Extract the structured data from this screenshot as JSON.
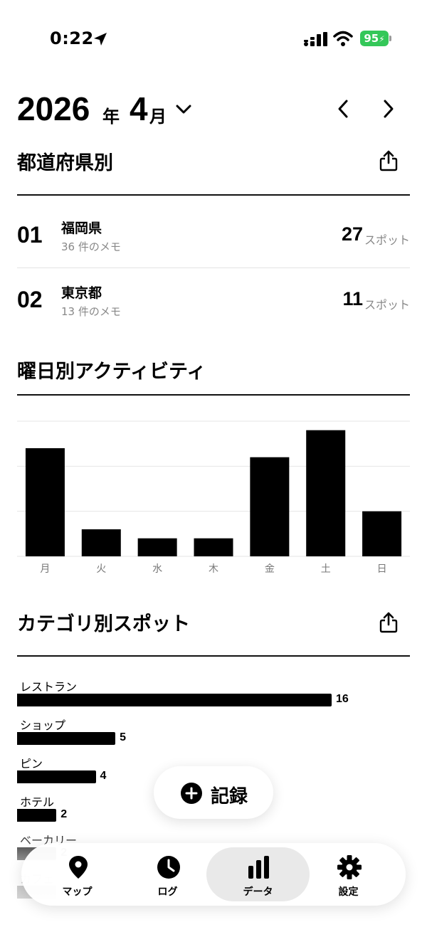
{
  "status_bar": {
    "time": "0:22",
    "battery": "95"
  },
  "header": {
    "year": "2026",
    "year_unit": "年",
    "month": "4",
    "month_unit": "月"
  },
  "prefectures": {
    "title": "都道府県別",
    "rows": [
      {
        "rank": "01",
        "name": "福岡県",
        "memo": "36 件のメモ",
        "count": "27",
        "unit": "スポット"
      },
      {
        "rank": "02",
        "name": "東京都",
        "memo": "13 件のメモ",
        "count": "11",
        "unit": "スポット"
      }
    ]
  },
  "weekday": {
    "title": "曜日別アクティビティ",
    "chart_data": {
      "type": "bar",
      "categories": [
        "月",
        "火",
        "水",
        "木",
        "金",
        "土",
        "日"
      ],
      "values": [
        12,
        3,
        2,
        2,
        11,
        14,
        5
      ],
      "ylim": [
        0,
        15
      ],
      "grid": true,
      "color": "#000000"
    }
  },
  "categories": {
    "title": "カテゴリ別スポット",
    "chart_data": {
      "type": "bar",
      "orientation": "horizontal",
      "categories": [
        "レストラン",
        "ショップ",
        "ピン",
        "ホテル",
        "ベーカリー",
        "カフェ"
      ],
      "values": [
        16,
        5,
        4,
        2,
        2,
        2
      ],
      "xlim": [
        0,
        16
      ]
    }
  },
  "record_button": {
    "label": "記録"
  },
  "tabs": [
    {
      "label": "マップ",
      "icon": "map-pin-icon",
      "active": false
    },
    {
      "label": "ログ",
      "icon": "clock-icon",
      "active": false
    },
    {
      "label": "データ",
      "icon": "bar-chart-icon",
      "active": true
    },
    {
      "label": "設定",
      "icon": "gear-icon",
      "active": false
    }
  ],
  "colors": {
    "accent": "#000000",
    "battery": "#34c759",
    "muted": "#888888"
  }
}
